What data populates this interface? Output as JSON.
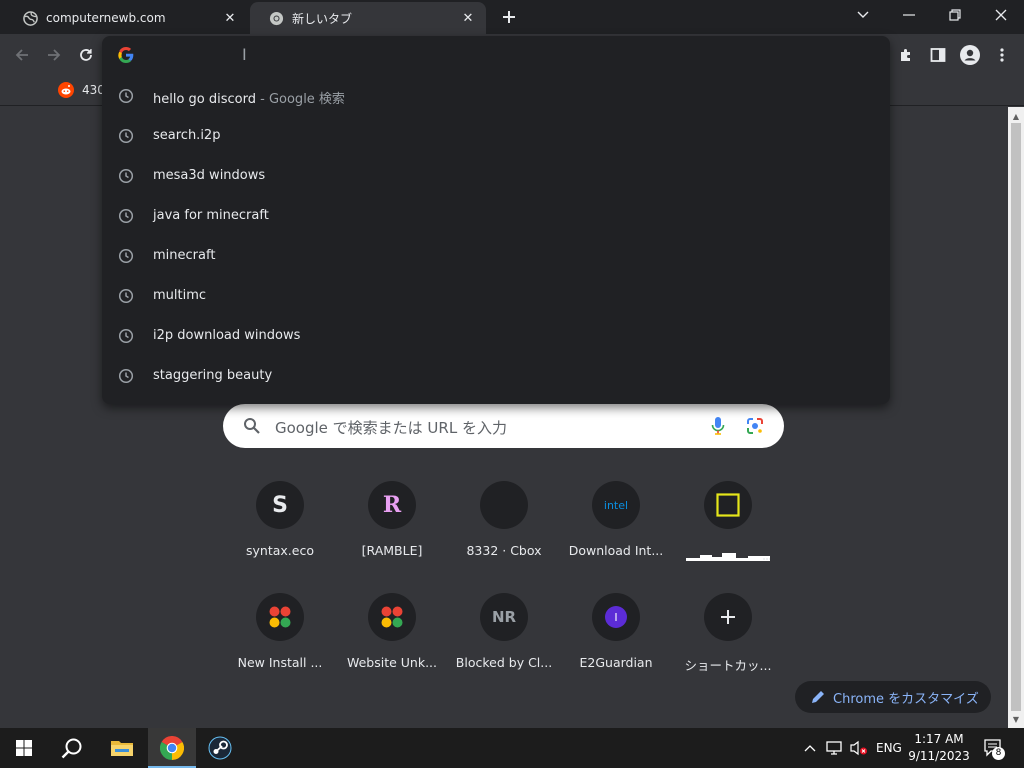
{
  "tabs": [
    {
      "title": "computernewb.com",
      "state": "inactive"
    },
    {
      "title": "新しいタブ",
      "state": "active"
    }
  ],
  "bookmarks": [
    {
      "label": "430"
    }
  ],
  "omnibox": {
    "suggestions": [
      {
        "text": "hello go discord",
        "desc": " - Google 検索"
      },
      {
        "text": "search.i2p",
        "desc": ""
      },
      {
        "text": "mesa3d windows",
        "desc": ""
      },
      {
        "text": "java for minecraft",
        "desc": ""
      },
      {
        "text": "minecraft",
        "desc": ""
      },
      {
        "text": "multimc",
        "desc": ""
      },
      {
        "text": "i2p download windows",
        "desc": ""
      },
      {
        "text": "staggering beauty",
        "desc": ""
      }
    ]
  },
  "ntp": {
    "search_placeholder": "Google で検索または URL を入力",
    "shortcuts": [
      {
        "label": "syntax.eco",
        "icon": "S"
      },
      {
        "label": "[RAMBLE]",
        "icon": "R"
      },
      {
        "label": "8332 · Cbox",
        "icon": ""
      },
      {
        "label": "Download Int...",
        "icon": "intel"
      },
      {
        "label": "",
        "icon": "yellow-square"
      },
      {
        "label": "New Install ...",
        "icon": "dots"
      },
      {
        "label": "Website Unk...",
        "icon": "dots"
      },
      {
        "label": "Blocked by Cl...",
        "icon": "NR"
      },
      {
        "label": "E2Guardian",
        "icon": "I"
      },
      {
        "label": "ショートカッ...",
        "icon": "+"
      }
    ],
    "customize_label": "Chrome をカスタマイズ"
  },
  "taskbar": {
    "lang": "ENG",
    "time": "1:17 AM",
    "date": "9/11/2023",
    "notifications": "8"
  },
  "colors": {
    "accent_blue": "#8ab4f8",
    "background": "#35363a",
    "dropdown": "#202124"
  }
}
